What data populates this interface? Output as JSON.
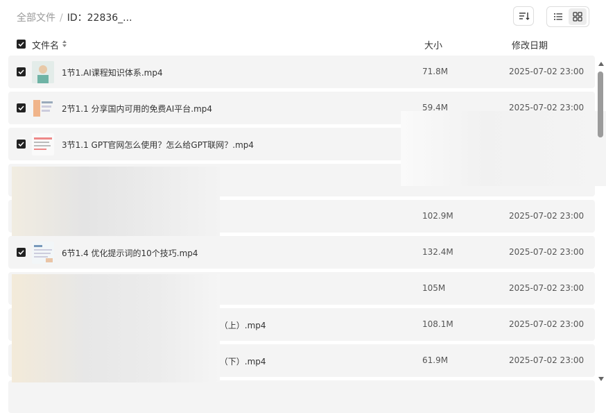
{
  "breadcrumb": {
    "root": "全部文件",
    "separator": "/",
    "current": "ID：22836_..."
  },
  "header": {
    "name": "文件名",
    "size": "大小",
    "date": "修改日期"
  },
  "rows": [
    {
      "name": "1节1.AI课程知识体系.mp4",
      "size": "71.8M",
      "date": "2025-07-02 23:00"
    },
    {
      "name": "2节1.1 分享国内可用的免费AI平台.mp4",
      "size": "59.4M",
      "date": "2025-07-02 23:00"
    },
    {
      "name": "3节1.1 GPT官网怎么使用？怎么给GPT联网？.mp4",
      "size": "",
      "date": ""
    },
    {
      "name": "",
      "size": "",
      "date": ""
    },
    {
      "name": "",
      "size": "102.9M",
      "date": "2025-07-02 23:00"
    },
    {
      "name": "6节1.4 优化提示词的10个技巧.mp4",
      "size": "132.4M",
      "date": "2025-07-02 23:00"
    },
    {
      "name": "",
      "size": "105M",
      "date": "2025-07-02 23:00"
    },
    {
      "name": "‹（上）.mp4",
      "size": "108.1M",
      "date": "2025-07-02 23:00"
    },
    {
      "name": "‹（下）.mp4",
      "size": "61.9M",
      "date": "2025-07-02 23:00"
    }
  ]
}
